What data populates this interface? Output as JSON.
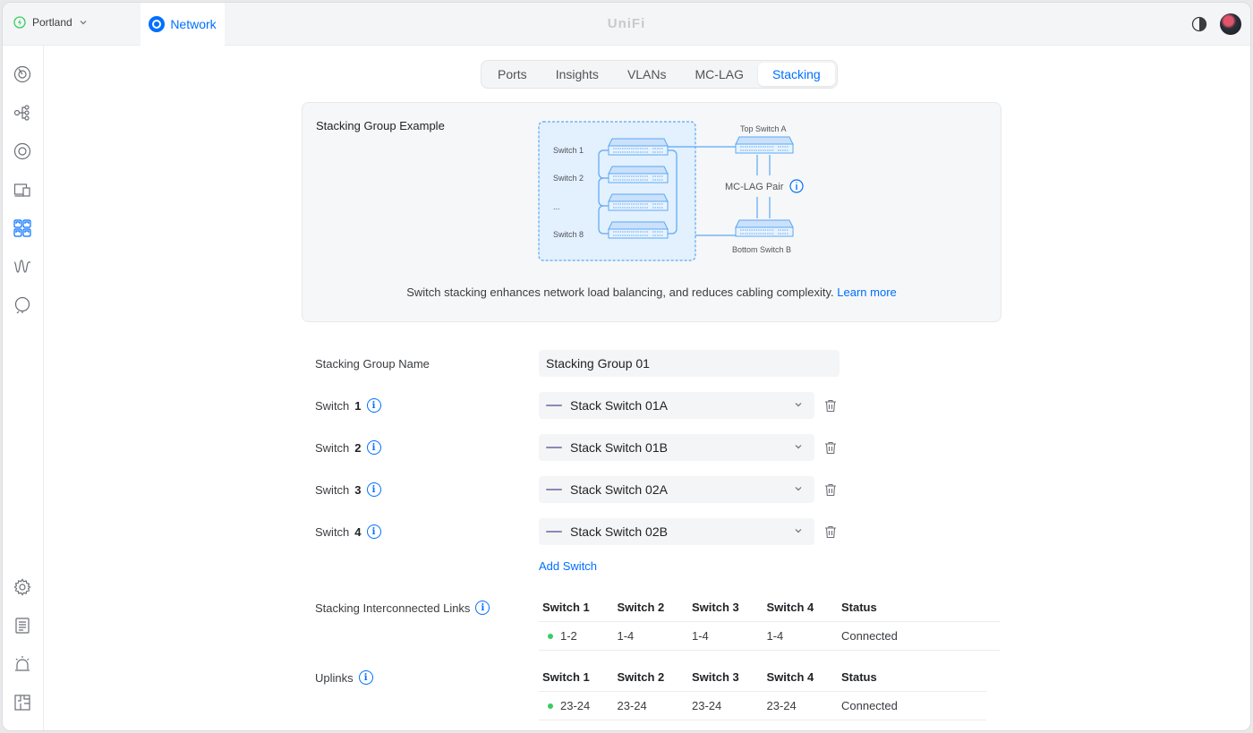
{
  "header": {
    "site_name": "Portland",
    "app_name": "Network",
    "logo_text": "UniFi"
  },
  "sidebar": {
    "top_icons": [
      "dashboard-icon",
      "topology-icon",
      "devices-icon",
      "client-devices-icon",
      "ports-icon",
      "insights-icon",
      "radius-icon"
    ],
    "bottom_icons": [
      "settings-icon",
      "logs-icon",
      "alarm-icon",
      "floorplan-icon"
    ]
  },
  "tabs": [
    "Ports",
    "Insights",
    "VLANs",
    "MC-LAG",
    "Stacking"
  ],
  "active_tab": "Stacking",
  "example": {
    "title": "Stacking Group Example",
    "diagram": {
      "switch1": "Switch  1",
      "switch2": "Switch  2",
      "ellipsis": "...",
      "switch8": "Switch  8",
      "top": "Top Switch  A",
      "pair": "MC-LAG Pair",
      "bottom": "Bottom Switch  B"
    },
    "caption": "Switch stacking enhances network load balancing, and reduces cabling complexity.",
    "learn_more": "Learn more"
  },
  "form": {
    "group_name_label": "Stacking Group Name",
    "group_name_value": "Stacking Group 01",
    "switch_label": "Switch",
    "switches": [
      {
        "num": "1",
        "value": "Stack Switch 01A"
      },
      {
        "num": "2",
        "value": "Stack Switch 01B"
      },
      {
        "num": "3",
        "value": "Stack Switch 02A"
      },
      {
        "num": "4",
        "value": "Stack Switch 02B"
      }
    ],
    "add_switch": "Add Switch"
  },
  "links_table": {
    "label": "Stacking Interconnected Links",
    "headers": [
      "Switch 1",
      "Switch 2",
      "Switch 3",
      "Switch 4",
      "Status"
    ],
    "row": [
      "1-2",
      "1-4",
      "1-4",
      "1-4",
      "Connected"
    ]
  },
  "uplinks_table": {
    "label": "Uplinks",
    "headers": [
      "Switch 1",
      "Switch 2",
      "Switch 3",
      "Switch 4",
      "Status"
    ],
    "row": [
      "23-24",
      "23-24",
      "23-24",
      "23-24",
      "Connected"
    ]
  },
  "colors": {
    "accent": "#006fff",
    "connected": "#38cc65",
    "diagram": "#5aa8f5"
  }
}
